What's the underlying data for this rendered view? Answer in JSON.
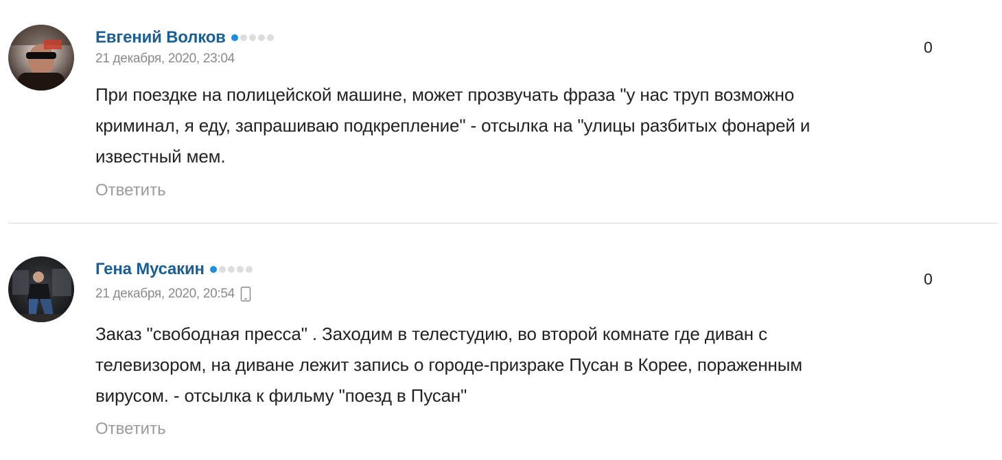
{
  "comments": [
    {
      "author": "Евгений Волков",
      "rating": 1,
      "rating_max": 5,
      "date": "21 декабря, 2020, 23:04",
      "posted_from_mobile": false,
      "score": "0",
      "text": "При поездке на полицейской машине, может прозвучать фраза \"у нас труп возможно\nкриминал, я еду, запрашиваю подкрепление\" - отсылка на \"улицы разбитых фонарей и\nизвестный мем.",
      "reply_label": "Ответить",
      "avatar_icon": "user-avatar-photo"
    },
    {
      "author": "Гена Мусакин",
      "rating": 1,
      "rating_max": 5,
      "date": "21 декабря, 2020, 20:54",
      "posted_from_mobile": true,
      "device_icon": "mobile-phone-icon",
      "score": "0",
      "text": "Заказ \"свободная пресса\" . Заходим в телестудию, во второй комнате где диван с\nтелевизором, на диване лежит запись о городе-призраке Пусан в Корее, пораженным\nвирусом. - отсылка к фильму \"поезд в Пусан\"",
      "reply_label": "Ответить",
      "avatar_icon": "user-avatar-photo"
    }
  ],
  "colors": {
    "author": "#1a5e96",
    "rating_on": "#1b8ee0",
    "rating_off": "#dddddd",
    "meta": "#8a8a8a",
    "reply": "#9a9a9a",
    "divider": "#d9d9d9"
  }
}
